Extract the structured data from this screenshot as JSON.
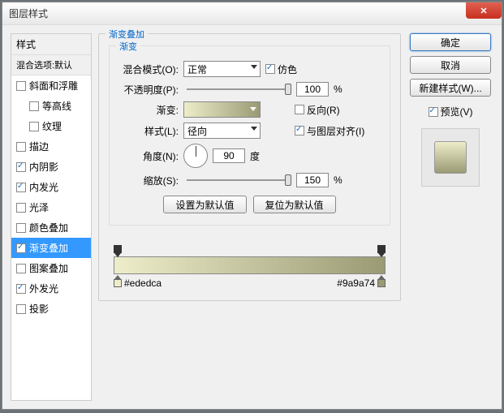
{
  "window": {
    "title": "图层样式"
  },
  "left": {
    "header": "样式",
    "subheader": "混合选项:默认",
    "items": [
      {
        "label": "斜面和浮雕",
        "checked": false,
        "indent": false
      },
      {
        "label": "等高线",
        "checked": false,
        "indent": true
      },
      {
        "label": "纹理",
        "checked": false,
        "indent": true
      },
      {
        "label": "描边",
        "checked": false,
        "indent": false
      },
      {
        "label": "内阴影",
        "checked": true,
        "indent": false
      },
      {
        "label": "内发光",
        "checked": true,
        "indent": false
      },
      {
        "label": "光泽",
        "checked": false,
        "indent": false
      },
      {
        "label": "颜色叠加",
        "checked": false,
        "indent": false
      },
      {
        "label": "渐变叠加",
        "checked": true,
        "selected": true,
        "indent": false
      },
      {
        "label": "图案叠加",
        "checked": false,
        "indent": false
      },
      {
        "label": "外发光",
        "checked": true,
        "indent": false
      },
      {
        "label": "投影",
        "checked": false,
        "indent": false
      }
    ]
  },
  "center": {
    "group_label": "渐变叠加",
    "inner_label": "渐变",
    "blend_mode_label": "混合模式(O):",
    "blend_mode_value": "正常",
    "dither_label": "仿色",
    "dither_checked": true,
    "opacity_label": "不透明度(P):",
    "opacity_value": "100",
    "percent": "%",
    "gradient_label": "渐变:",
    "reverse_label": "反向(R)",
    "reverse_checked": false,
    "style_label": "样式(L):",
    "style_value": "径向",
    "align_label": "与图层对齐(I)",
    "align_checked": true,
    "angle_label": "角度(N):",
    "angle_value": "90",
    "angle_unit": "度",
    "scale_label": "缩放(S):",
    "scale_value": "150",
    "reset_default": "设置为默认值",
    "restore_default": "复位为默认值",
    "stop_left": "#ededca",
    "stop_right": "#9a9a74"
  },
  "right": {
    "ok": "确定",
    "cancel": "取消",
    "new_style": "新建样式(W)...",
    "preview_label": "预览(V)",
    "preview_checked": true
  }
}
